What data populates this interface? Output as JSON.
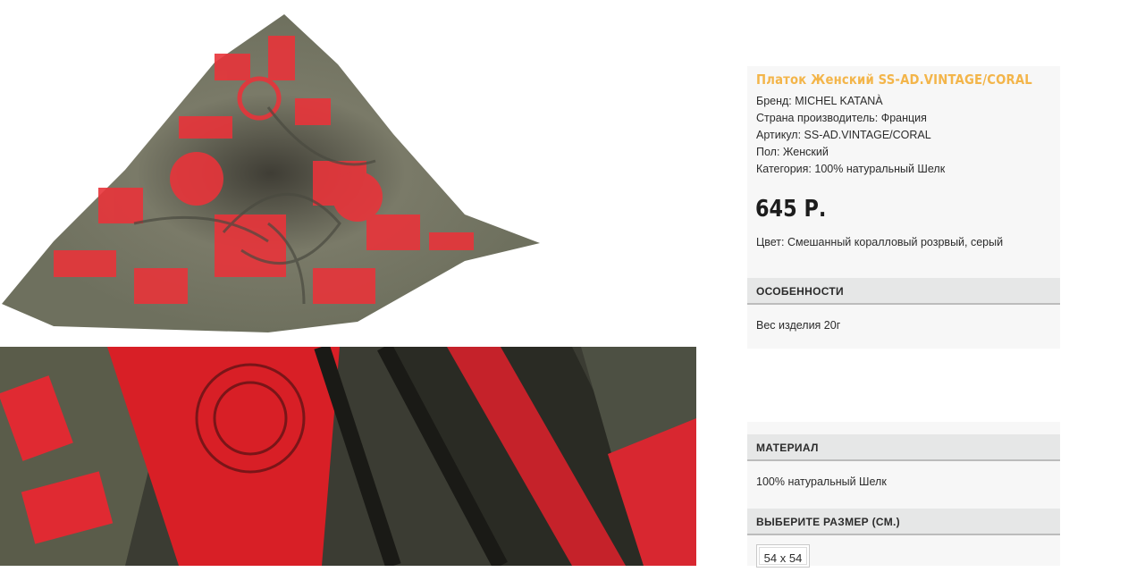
{
  "product": {
    "title": "Платок Женский SS-AD.VINTAGE/CORAL",
    "specs": {
      "brand": "Бренд: MICHEL KATANÀ",
      "country": "Страна производитель: Франция",
      "sku": "Артикул: SS-AD.VINTAGE/CORAL",
      "gender": "Пол: Женский",
      "category": "Категория: 100% натуральный Шелк"
    },
    "price": "645 Р.",
    "color": "Цвет: Смешанный коралловый розрвый, серый"
  },
  "features": {
    "heading": "ОСОБЕННОСТИ",
    "text": "Вес изделия 20г"
  },
  "material": {
    "heading": "МАТЕРИАЛ",
    "text": "100% натуральный Шелк"
  },
  "size": {
    "heading": "ВЫБЕРИТЕ РАЗМЕР (СМ.)",
    "options": [
      "54 x 54"
    ]
  },
  "colors": {
    "title_accent": "#f3b54a",
    "section_bg": "#e6e7e7",
    "card_bg": "#f7f7f7",
    "scarf_coral": "#e8343a",
    "scarf_grey": "#6b705f"
  }
}
